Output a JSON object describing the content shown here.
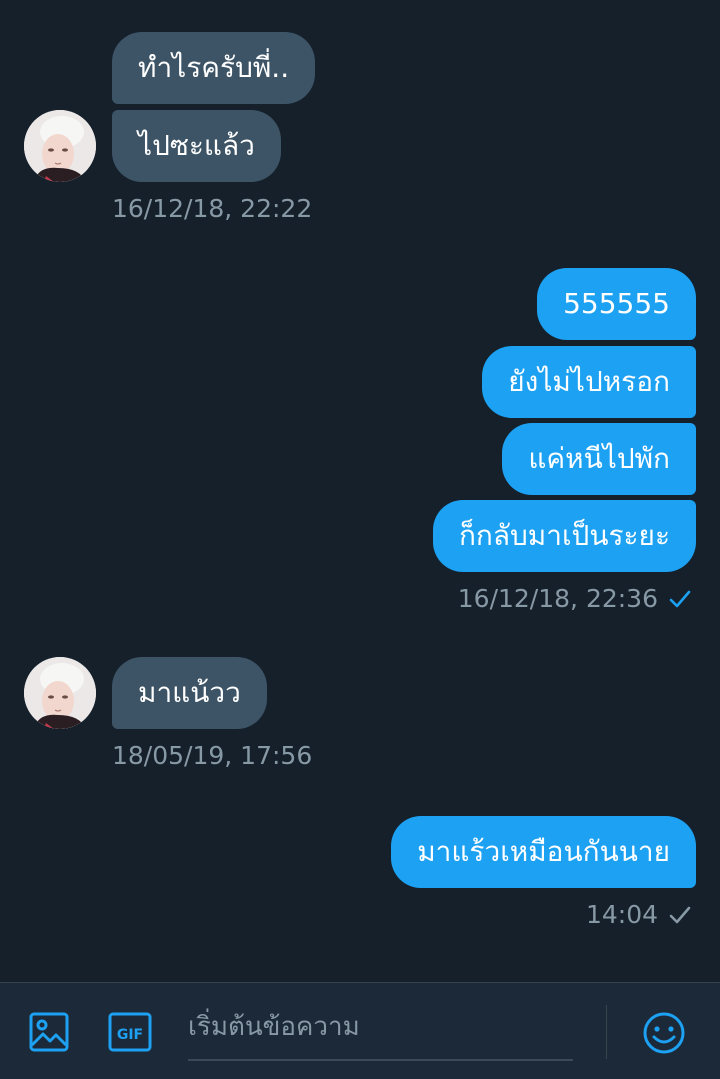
{
  "conversation": {
    "group1": {
      "messages": [
        "ทำไรครับพี่..",
        "ไปซะแล้ว"
      ],
      "timestamp": "16/12/18, 22:22"
    },
    "group2": {
      "messages": [
        "555555",
        "ยังไม่ไปหรอก",
        "แค่หนีไปพัก",
        "ก็กลับมาเป็นระยะ"
      ],
      "timestamp": "16/12/18, 22:36",
      "status": "sent"
    },
    "group3": {
      "messages": [
        "มาแน้วว"
      ],
      "timestamp": "18/05/19, 17:56"
    },
    "group4": {
      "messages": [
        "มาแร้วเหมือนกันนาย"
      ],
      "timestamp": "14:04",
      "status": "delivered"
    }
  },
  "composer": {
    "placeholder": "เริ่มต้นข้อความ",
    "gif_label": "GIF",
    "icons": [
      "image-icon",
      "gif-icon",
      "emoji-icon"
    ]
  },
  "colors": {
    "background": "#15202b",
    "incoming_bubble": "#3d5466",
    "outgoing_bubble": "#1da1f2",
    "accent": "#1da1f2",
    "muted_text": "#8899a6"
  }
}
